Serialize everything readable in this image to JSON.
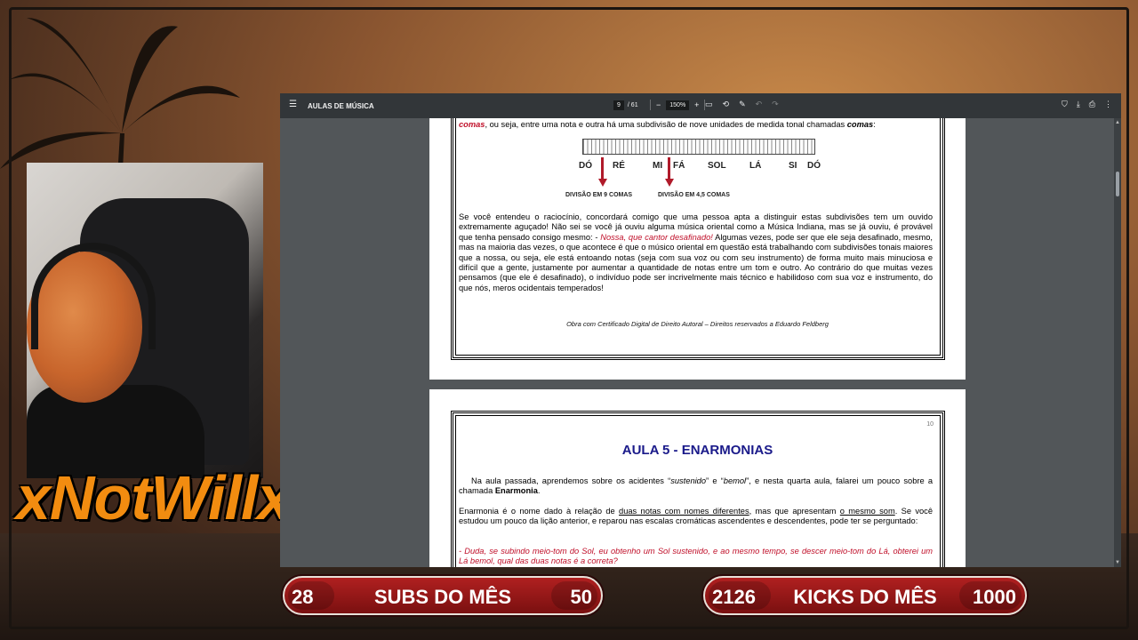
{
  "overlay": {
    "streamer_name": "xNotWillx",
    "subs_bar": {
      "current": "28",
      "label": "SUBS DO MÊS",
      "goal": "50"
    },
    "kicks_bar": {
      "current": "2126",
      "label": "KICKS DO MÊS",
      "goal": "1000"
    },
    "accent_color": "#f28c10",
    "bar_color": "#b02020"
  },
  "viewer": {
    "title": "AULAS DE MÚSICA",
    "page_current": "9",
    "page_total": "/ 61",
    "zoom": "150%",
    "icons": [
      "menu-icon",
      "zoom-out-icon",
      "zoom-in-icon",
      "fit-page-icon",
      "rotate-icon",
      "annotate-icon",
      "undo-icon",
      "redo-icon",
      "save-icon",
      "download-icon",
      "print-icon",
      "more-icon"
    ]
  },
  "page1": {
    "intro_bold": "comas",
    "intro_rest": ", ou seja, entre uma nota e outra há uma subdivisão de nove unidades de medida tonal chamadas ",
    "intro_end_bold": "comas",
    "intro_colon": ":",
    "notes": [
      "DÓ",
      "RÉ",
      "MI",
      "FÁ",
      "SOL",
      "LÁ",
      "SI",
      "DÓ"
    ],
    "division_left": "DIVISÃO EM 9 COMAS",
    "division_right": "DIVISÃO EM 4,5 COMAS",
    "para_start": "Se você entendeu o raciocínio, concordará comigo que uma pessoa apta a distinguir estas subdivisões tem um ouvido extremamente aguçado! Não sei se você já ouviu alguma música oriental como a Música Indiana, mas se já ouviu, é provável que tenha pensado consigo mesmo: - ",
    "para_quote": "Nossa, que cantor desafinado!",
    "para_end": " Algumas vezes, pode ser que ele seja desafinado, mesmo, mas na maioria das vezes, o que acontece é que o músico oriental em questão está trabalhando com subdivisões tonais maiores que a nossa, ou seja, ele está entoando notas (seja com sua voz ou com seu instrumento) de forma muito mais minuciosa e difícil que a gente, justamente por aumentar a quantidade de notas entre um tom e outro. Ao contrário do que muitas vezes pensamos (que ele é desafinado), o indivíduo pode ser incrivelmente mais técnico e habilidoso com sua voz e instrumento, do que nós, meros ocidentais temperados!",
    "footer": "Obra com Certificado Digital de Direito Autoral – Direitos reservados a Eduardo Feldberg"
  },
  "page2": {
    "page_number": "10",
    "title": "AULA 5 - ENARMONIAS",
    "p1_a": "Na aula passada, aprendemos sobre os acidentes “",
    "p1_sust": "sustenido",
    "p1_b": "” e “",
    "p1_bemol": "bemol",
    "p1_c": "”, e nesta quarta aula, falarei um pouco sobre a chamada ",
    "p1_bold": "Enarmonia",
    "p1_d": ".",
    "p2_a": "Enarmonia é o nome dado à relação de ",
    "p2_u1": "duas notas com nomes diferentes",
    "p2_b": ", mas que apresentam ",
    "p2_u2": "o mesmo som",
    "p2_c": ". Se você estudou um pouco da lição anterior, e reparou nas escalas cromáticas ascendentes e descendentes, pode ter se perguntado:",
    "p3": "- Duda, se subindo meio-tom do Sol, eu obtenho um Sol sustenido, e ao mesmo tempo, se descer meio-tom do Lá, obterei um Lá bemol, qual das duas notas é a correta?"
  }
}
